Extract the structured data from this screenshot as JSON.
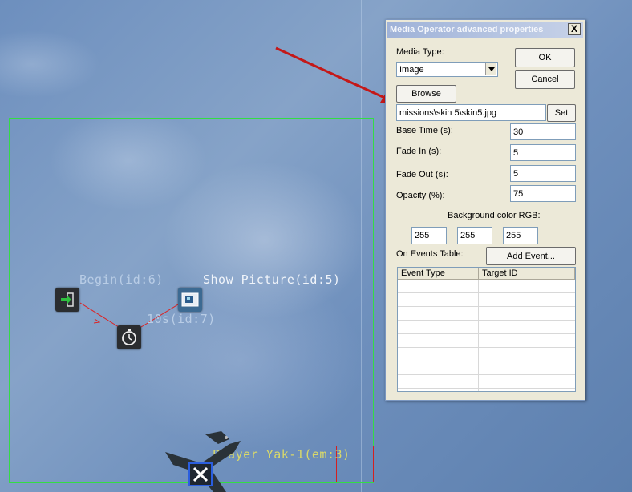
{
  "map": {
    "nodes": {
      "begin_label": "Begin(id:6)",
      "show_picture_label": "Show Picture(id:5)",
      "timer_label": "10s(id:7)",
      "player_label": "Player Yak-1(em:3)"
    }
  },
  "dialog": {
    "title": "Media Operator advanced properties",
    "close_glyph": "X",
    "media_type_label": "Media Type:",
    "media_type_value": "Image",
    "ok_label": "OK",
    "cancel_label": "Cancel",
    "browse_label": "Browse",
    "path_value": "missions\\skin 5\\skin5.jpg",
    "set_label": "Set",
    "base_time_label": "Base Time (s):",
    "base_time_value": "30",
    "fade_in_label": "Fade In (s):",
    "fade_in_value": "5",
    "fade_out_label": "Fade Out (s):",
    "fade_out_value": "5",
    "opacity_label": "Opacity (%):",
    "opacity_value": "75",
    "bg_color_label": "Background color RGB:",
    "bg_r": "255",
    "bg_g": "255",
    "bg_b": "255",
    "events_label": "On Events Table:",
    "add_event_label": "Add Event...",
    "table_headers": [
      "Event Type",
      "Target ID"
    ]
  },
  "colors": {
    "zone_green": "#33dd44",
    "arrow_red": "#c41818",
    "label_cyan": "#9fd8ec",
    "label_yellow": "#d8d86a"
  }
}
